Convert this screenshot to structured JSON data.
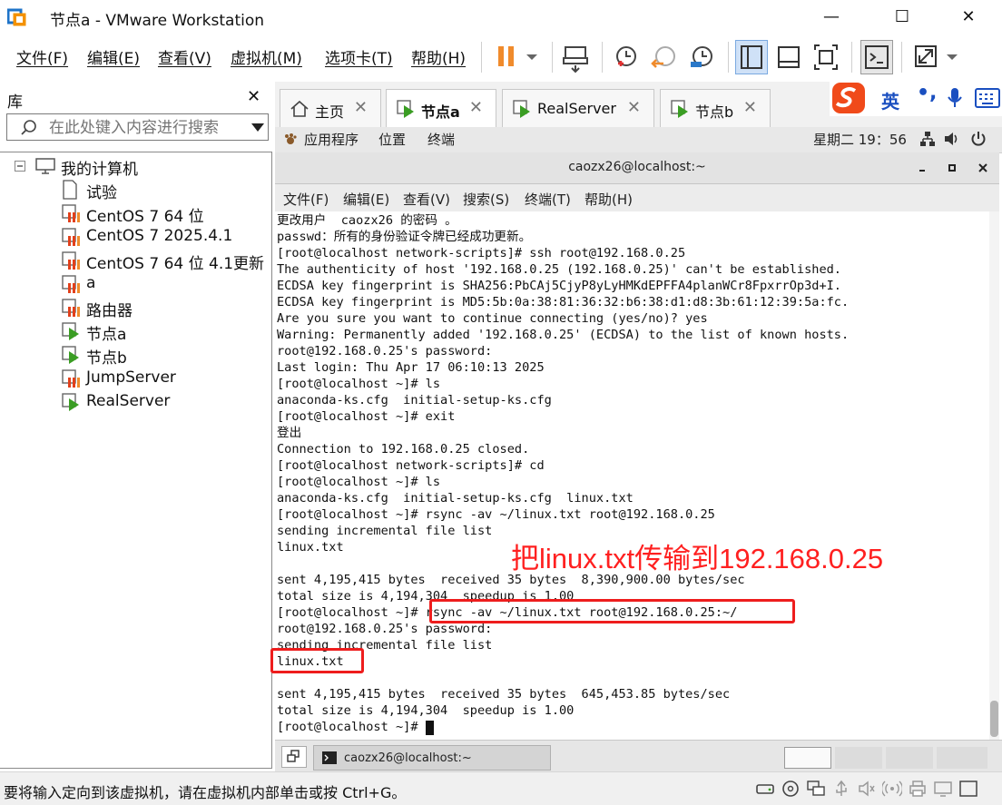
{
  "window": {
    "title": "节点a - VMware Workstation",
    "minimize": "—",
    "maximize": "☐",
    "close": "✕"
  },
  "menu": [
    "文件(F)",
    "编辑(E)",
    "查看(V)",
    "虚拟机(M)",
    "选项卡(T)",
    "帮助(H)"
  ],
  "library": {
    "title": "库",
    "close": "✕",
    "search_placeholder": "在此处键入内容进行搜索",
    "root": "我的计算机",
    "items": [
      {
        "label": "试验",
        "icon": "document-icon"
      },
      {
        "label": "CentOS 7 64 位",
        "icon": "vm-off-icon"
      },
      {
        "label": "CentOS 7 2025.4.1",
        "icon": "vm-off-icon"
      },
      {
        "label": "CentOS 7 64 位 4.1更新",
        "icon": "vm-off-icon"
      },
      {
        "label": "a",
        "icon": "vm-off-icon"
      },
      {
        "label": "路由器",
        "icon": "vm-off-icon"
      },
      {
        "label": "节点a",
        "icon": "vm-running-icon"
      },
      {
        "label": "节点b",
        "icon": "vm-running-icon"
      },
      {
        "label": "JumpServer",
        "icon": "vm-off-icon"
      },
      {
        "label": "RealServer",
        "icon": "vm-running-icon"
      }
    ]
  },
  "tabs": [
    {
      "label": "主页",
      "close": "✕"
    },
    {
      "label": "节点a",
      "close": "✕"
    },
    {
      "label": "RealServer",
      "close": "✕"
    },
    {
      "label": "节点b",
      "close": "✕"
    }
  ],
  "ime": {
    "mode": "英",
    "punct": "•,"
  },
  "guest": {
    "apps": "应用程序",
    "places": "位置",
    "terminal": "终端",
    "clock": "星期二 19：56"
  },
  "terminal": {
    "title": "caozx26@localhost:~",
    "menu": [
      "文件(F)",
      "编辑(E)",
      "查看(V)",
      "搜索(S)",
      "终端(T)",
      "帮助(H)"
    ],
    "lines": [
      "更改用户  caozx26 的密码 。",
      "passwd：所有的身份验证令牌已经成功更新。",
      "[root@localhost network-scripts]# ssh root@192.168.0.25",
      "The authenticity of host '192.168.0.25 (192.168.0.25)' can't be established.",
      "ECDSA key fingerprint is SHA256:PbCAj5CjyP8yLyHMKdEPFFA4planWCr8FpxrrOp3d+I.",
      "ECDSA key fingerprint is MD5:5b:0a:38:81:36:32:b6:38:d1:d8:3b:61:12:39:5a:fc.",
      "Are you sure you want to continue connecting (yes/no)? yes",
      "Warning: Permanently added '192.168.0.25' (ECDSA) to the list of known hosts.",
      "root@192.168.0.25's password:",
      "Last login: Thu Apr 17 06:10:13 2025",
      "[root@localhost ~]# ls",
      "anaconda-ks.cfg  initial-setup-ks.cfg",
      "[root@localhost ~]# exit",
      "登出",
      "Connection to 192.168.0.25 closed.",
      "[root@localhost network-scripts]# cd",
      "[root@localhost ~]# ls",
      "anaconda-ks.cfg  initial-setup-ks.cfg  linux.txt",
      "[root@localhost ~]# rsync -av ~/linux.txt root@192.168.0.25",
      "sending incremental file list",
      "linux.txt",
      "",
      "sent 4,195,415 bytes  received 35 bytes  8,390,900.00 bytes/sec",
      "total size is 4,194,304  speedup is 1.00",
      "[root@localhost ~]# rsync -av ~/linux.txt root@192.168.0.25:~/",
      "root@192.168.0.25's password:",
      "sending incremental file list",
      "linux.txt",
      "",
      "sent 4,195,415 bytes  received 35 bytes  645,453.85 bytes/sec",
      "total size is 4,194,304  speedup is 1.00",
      "[root@localhost ~]# "
    ]
  },
  "annotation": "把linux.txt传输到192.168.0.25",
  "taskbar": {
    "window": "caozx26@localhost:~"
  },
  "status": "要将输入定向到该虚拟机，请在虚拟机内部单击或按 Ctrl+G。",
  "colors": {
    "accent_red": "#ee1d1d",
    "pause_orange": "#f08b2c",
    "vm_green": "#3a9d23"
  }
}
